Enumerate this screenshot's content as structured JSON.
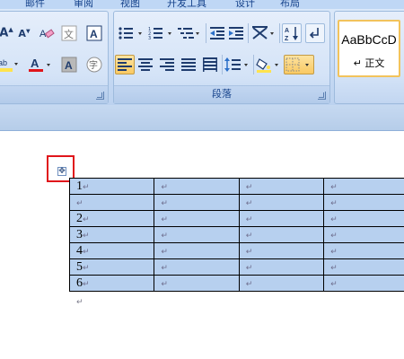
{
  "ribbon": {
    "tabs_partial": [
      "邮件",
      "审阅",
      "视图",
      "开发工具",
      "设计",
      "布局"
    ],
    "font_group": {
      "row1": [
        "A↑",
        "A↓",
        "清除格式",
        "拼音指南",
        "字符边框"
      ],
      "row2": [
        "以不同颜色突出显示文本",
        "字体颜色",
        "字符底纹",
        "带圈字符"
      ]
    },
    "paragraph_group": {
      "label": "段落",
      "row1": [
        "项目符号",
        "编号",
        "多级列表",
        "减少缩进量",
        "增加缩进量",
        "中文版式",
        "排序",
        "显示/隐藏编辑标记"
      ],
      "row2": [
        "文本左对齐",
        "居中",
        "文本右对齐",
        "两端对齐",
        "分散对齐",
        "行距",
        "底纹",
        "边框"
      ]
    },
    "style_group": {
      "sample": "AaBbCcD",
      "name": "↵ 正文"
    },
    "colors": {
      "font_color": "#e0151b",
      "highlight": "#ffe34d",
      "accent_pressed": "#f9c962"
    }
  },
  "document": {
    "table": {
      "rows": [
        [
          "1↵",
          "↵",
          "↵",
          "↵"
        ],
        [
          "↵",
          "↵",
          "↵",
          "↵"
        ],
        [
          "2↵",
          "↵",
          "↵",
          "↵"
        ],
        [
          "3↵",
          "↵",
          "↵",
          "↵"
        ],
        [
          "4↵",
          "↵",
          "↵",
          "↵"
        ],
        [
          "5↵",
          "↵",
          "↵",
          "↵"
        ],
        [
          "6↵",
          "↵",
          "↵",
          "↵"
        ]
      ]
    },
    "table_move_handle": "✥",
    "paragraph_mark": "↵"
  }
}
